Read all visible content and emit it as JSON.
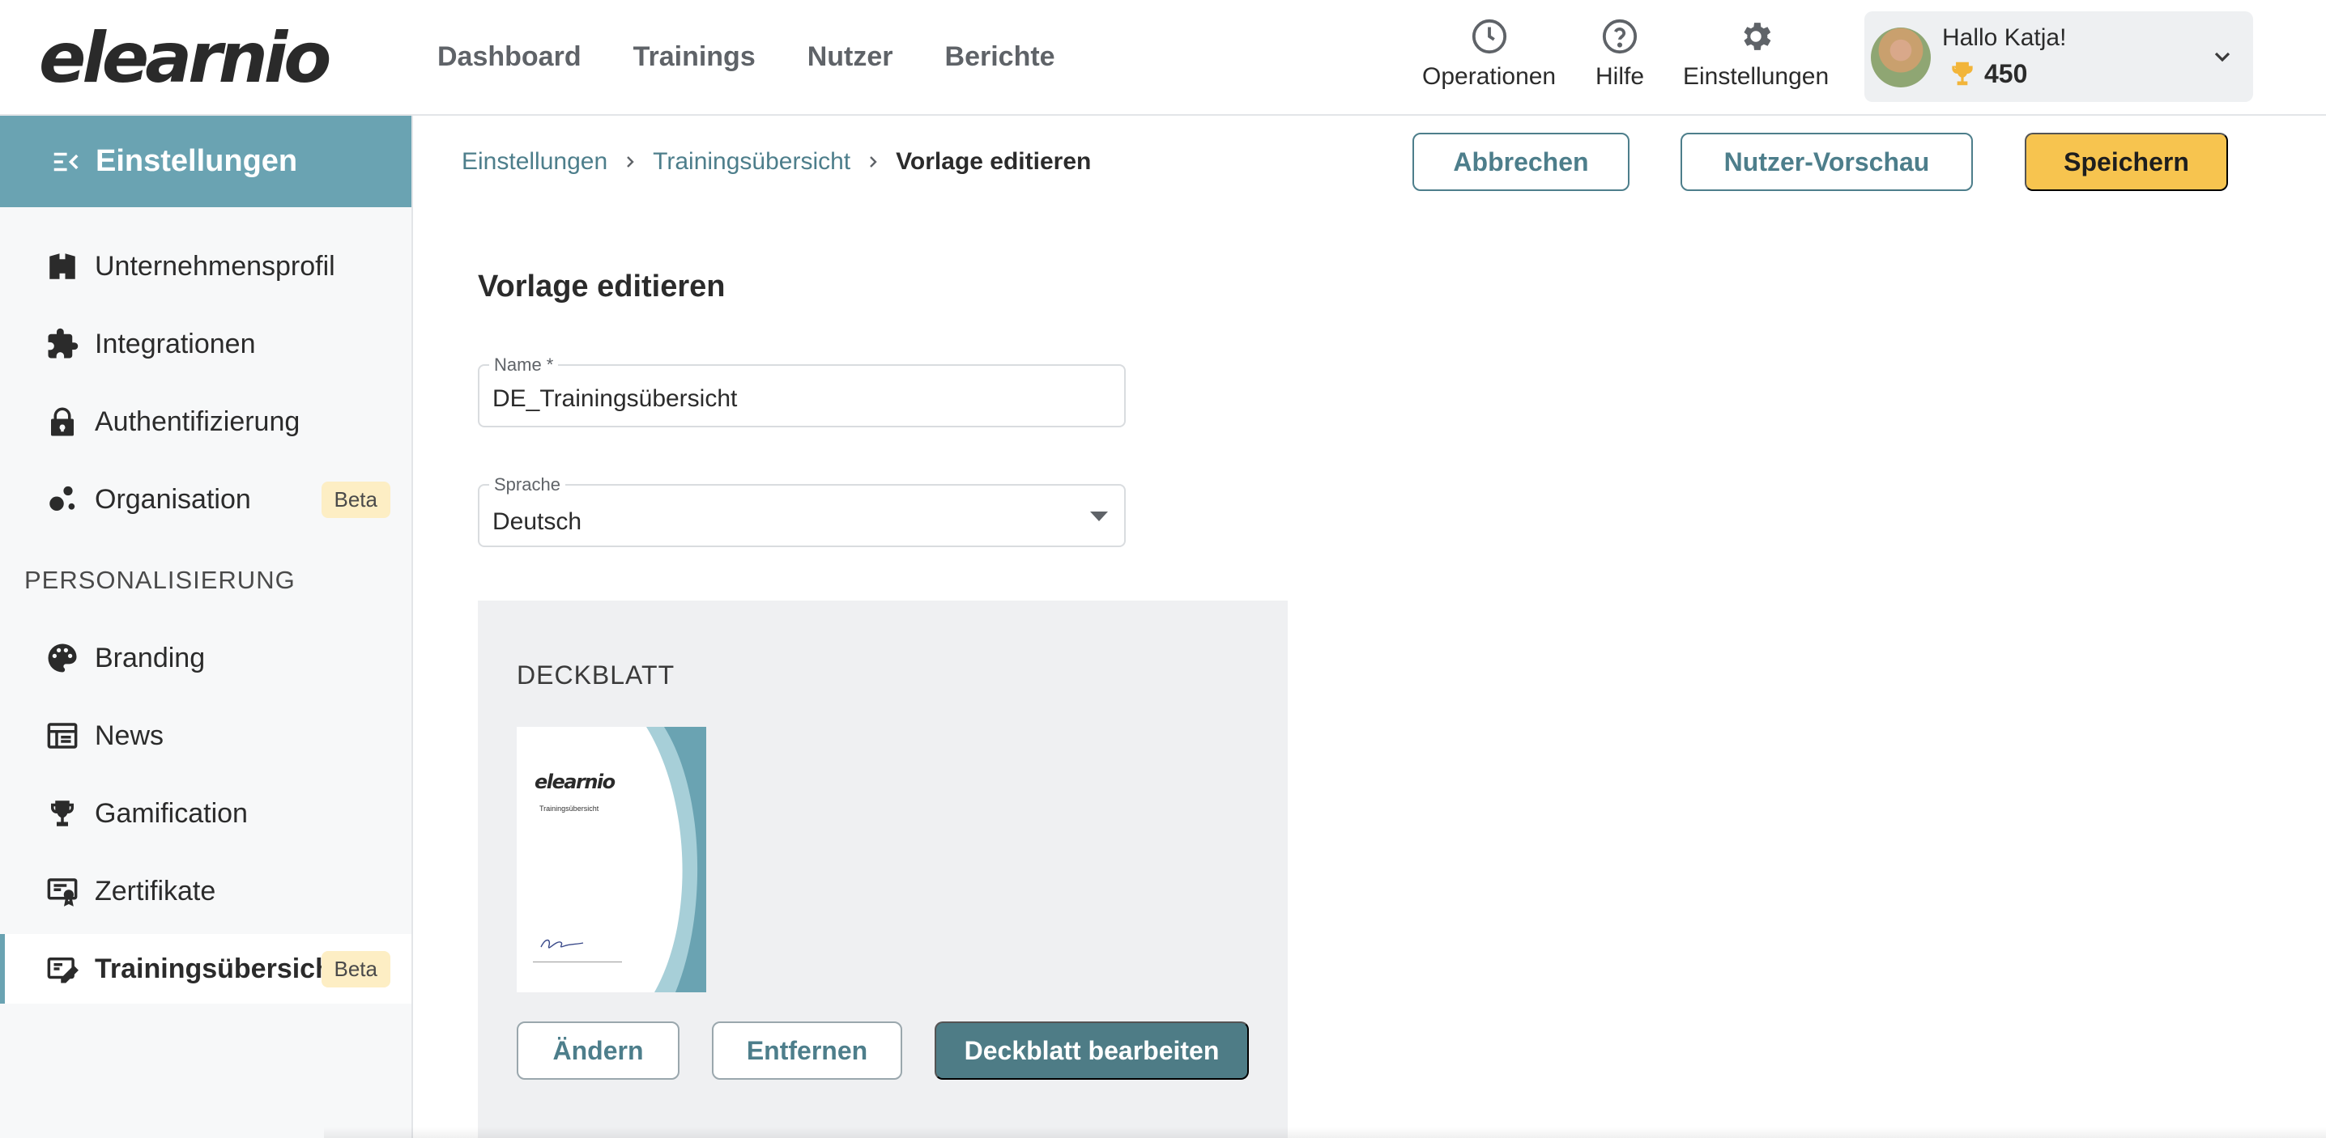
{
  "brand": {
    "logo_text": "elearnio",
    "accent": "#6aa3b2",
    "primary_button": "#f7c44f",
    "dark_button": "#4e7c86",
    "link": "#4d7e8b",
    "badge_bg": "#fdeec4"
  },
  "topnav": {
    "items": [
      "Dashboard",
      "Trainings",
      "Nutzer",
      "Berichte"
    ],
    "actions": [
      {
        "label": "Operationen",
        "icon": "clock-icon"
      },
      {
        "label": "Hilfe",
        "icon": "help-circle-icon"
      },
      {
        "label": "Einstellungen",
        "icon": "gear-icon"
      }
    ],
    "user": {
      "greeting": "Hallo Katja!",
      "points": "450"
    }
  },
  "sidebar": {
    "header": "Einstellungen",
    "items": [
      {
        "label": "Unternehmensprofil",
        "icon": "building-icon"
      },
      {
        "label": "Integrationen",
        "icon": "puzzle-icon"
      },
      {
        "label": "Authentifizierung",
        "icon": "lock-icon"
      },
      {
        "label": "Organisation",
        "icon": "org-nodes-icon",
        "badge": "Beta"
      }
    ],
    "section_label": "PERSONALISIERUNG",
    "personal_items": [
      {
        "label": "Branding",
        "icon": "palette-icon"
      },
      {
        "label": "News",
        "icon": "newspaper-icon"
      },
      {
        "label": "Gamification",
        "icon": "trophy-icon"
      },
      {
        "label": "Zertifikate",
        "icon": "certificate-icon"
      },
      {
        "label": "Trainingsübersicht",
        "icon": "training-overview-icon",
        "badge": "Beta",
        "active": true
      }
    ]
  },
  "breadcrumb": {
    "items": [
      "Einstellungen",
      "Trainingsübersicht"
    ],
    "current": "Vorlage editieren"
  },
  "actions": {
    "cancel": "Abbrechen",
    "preview": "Nutzer-Vorschau",
    "save": "Speichern"
  },
  "form": {
    "title": "Vorlage editieren",
    "name_label": "Name *",
    "name_value": "DE_Trainingsübersicht",
    "language_label": "Sprache",
    "language_value": "Deutsch"
  },
  "cover": {
    "title": "DECKBLATT",
    "thumbnail": {
      "logo_text": "elearnio",
      "subtitle": "Trainingsübersicht"
    },
    "buttons": {
      "change": "Ändern",
      "remove": "Entfernen",
      "edit": "Deckblatt bearbeiten"
    }
  }
}
